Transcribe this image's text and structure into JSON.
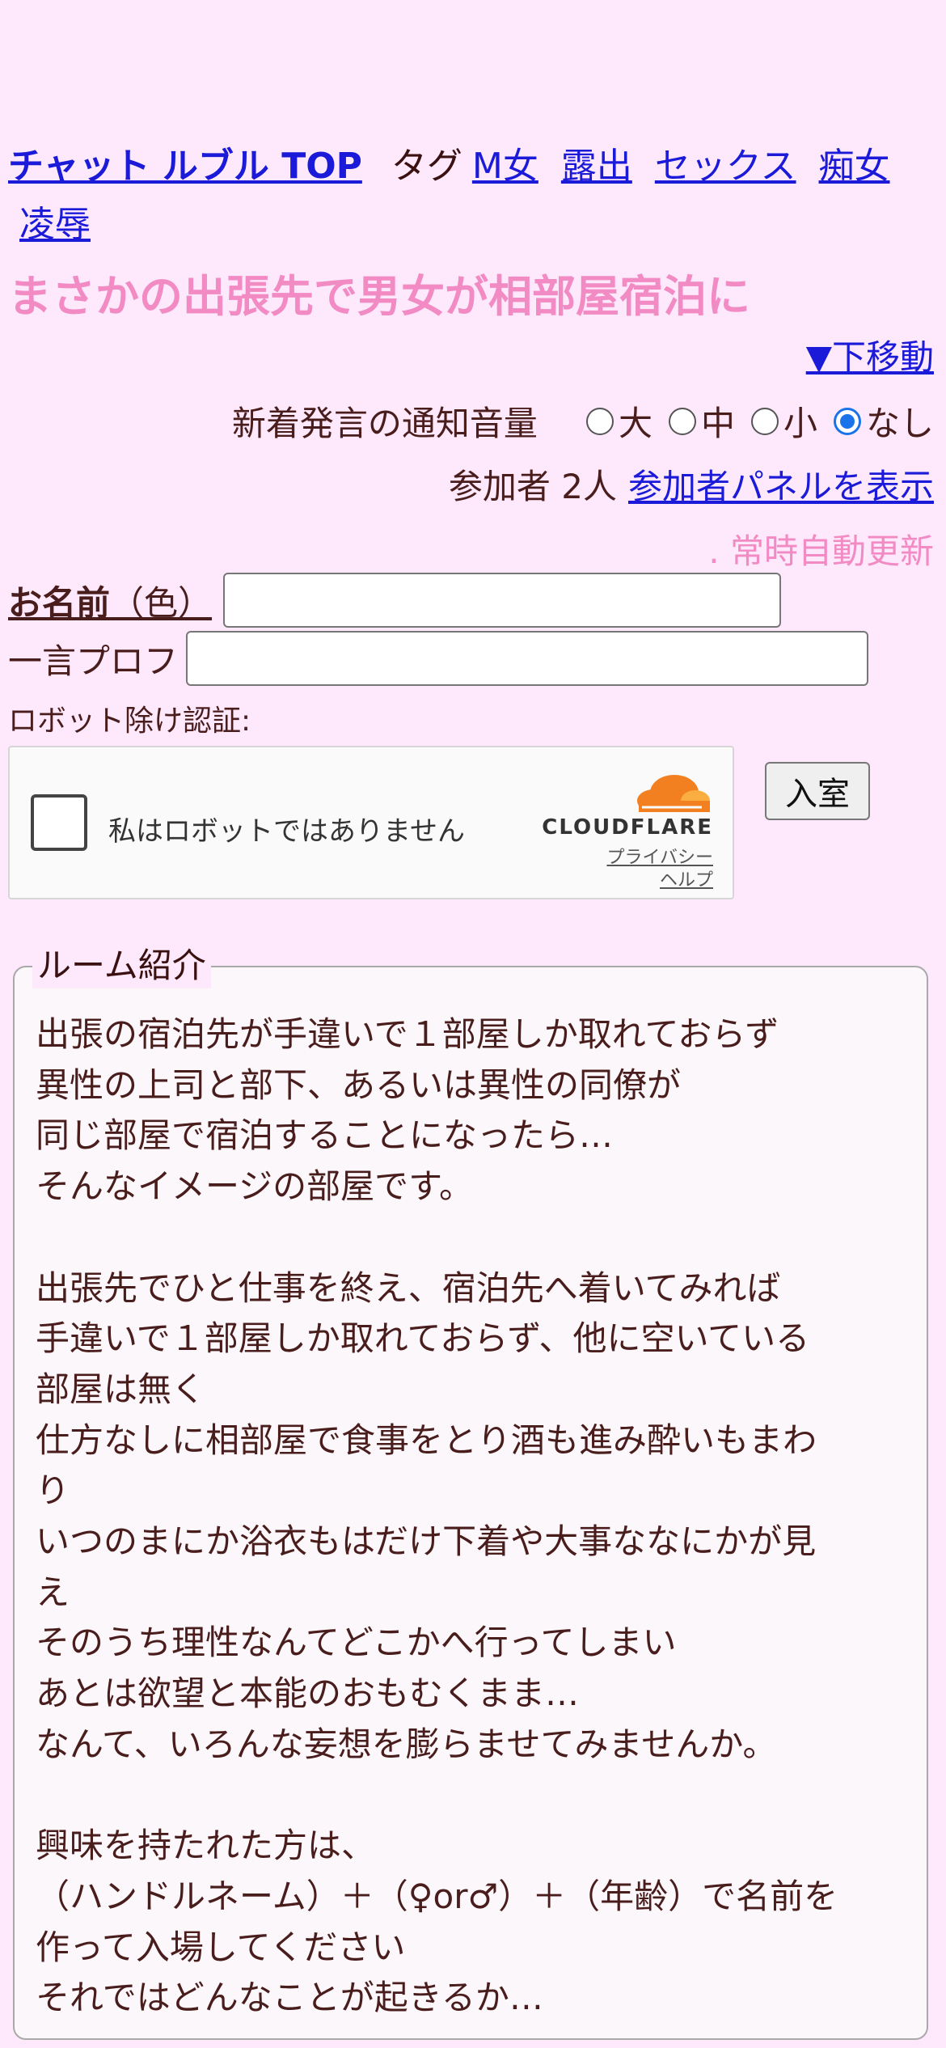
{
  "nav": {
    "brand": "チャット ルブル TOP",
    "tag_label": "タグ",
    "tags": [
      "M女",
      "露出",
      "セックス",
      "痴女",
      "凌辱"
    ]
  },
  "room_title": "まさかの出張先で男女が相部屋宿泊に",
  "move_down": "▼下移動",
  "notify": {
    "label": "新着発言の通知音量",
    "options": [
      "大",
      "中",
      "小",
      "なし"
    ],
    "selected": "なし"
  },
  "participants": {
    "count_text": "参加者 2人",
    "panel_link": "参加者パネルを表示"
  },
  "auto_update": ". 常時自動更新",
  "form": {
    "name_label_bold": "お名前",
    "name_label_rest": "（色）",
    "name_value": "",
    "prof_label": "一言プロフ",
    "prof_value": "",
    "robot_label": "ロボット除け認証:",
    "enter_button": "入室"
  },
  "captcha": {
    "text": "私はロボットではありません",
    "brand": "CLOUDFLARE",
    "privacy": "プライバシー",
    "help": "ヘルプ"
  },
  "intro": {
    "legend": "ルーム紹介",
    "lines": [
      "出張の宿泊先が手違いで１部屋しか取れておらず",
      "異性の上司と部下、あるいは異性の同僚が",
      "同じ部屋で宿泊することになったら…",
      "そんなイメージの部屋です。",
      "",
      "出張先でひと仕事を終え、宿泊先へ着いてみれば",
      "手違いで１部屋しか取れておらず、他に空いている",
      "部屋は無く",
      "仕方なしに相部屋で食事をとり酒も進み酔いもまわ",
      "り",
      "いつのまにか浴衣もはだけ下着や大事ななにかが見",
      "え",
      "そのうち理性なんてどこかへ行ってしまい",
      "あとは欲望と本能のおもむくまま…",
      "なんて、いろんな妄想を膨らませてみませんか。",
      "",
      "興味を持たれた方は、",
      "（ハンドルネーム）＋（♀or♂）＋（年齢）で名前を",
      "作って入場してください",
      "それではどんなことが起きるか…"
    ]
  },
  "colors": {
    "background": "#fde9fb",
    "title_pink": "#f28ac4",
    "link_blue": "#1a1ad8",
    "text": "#4a1d1d",
    "radio_accent": "#1a73e8",
    "cloudflare_orange": "#f38020"
  }
}
